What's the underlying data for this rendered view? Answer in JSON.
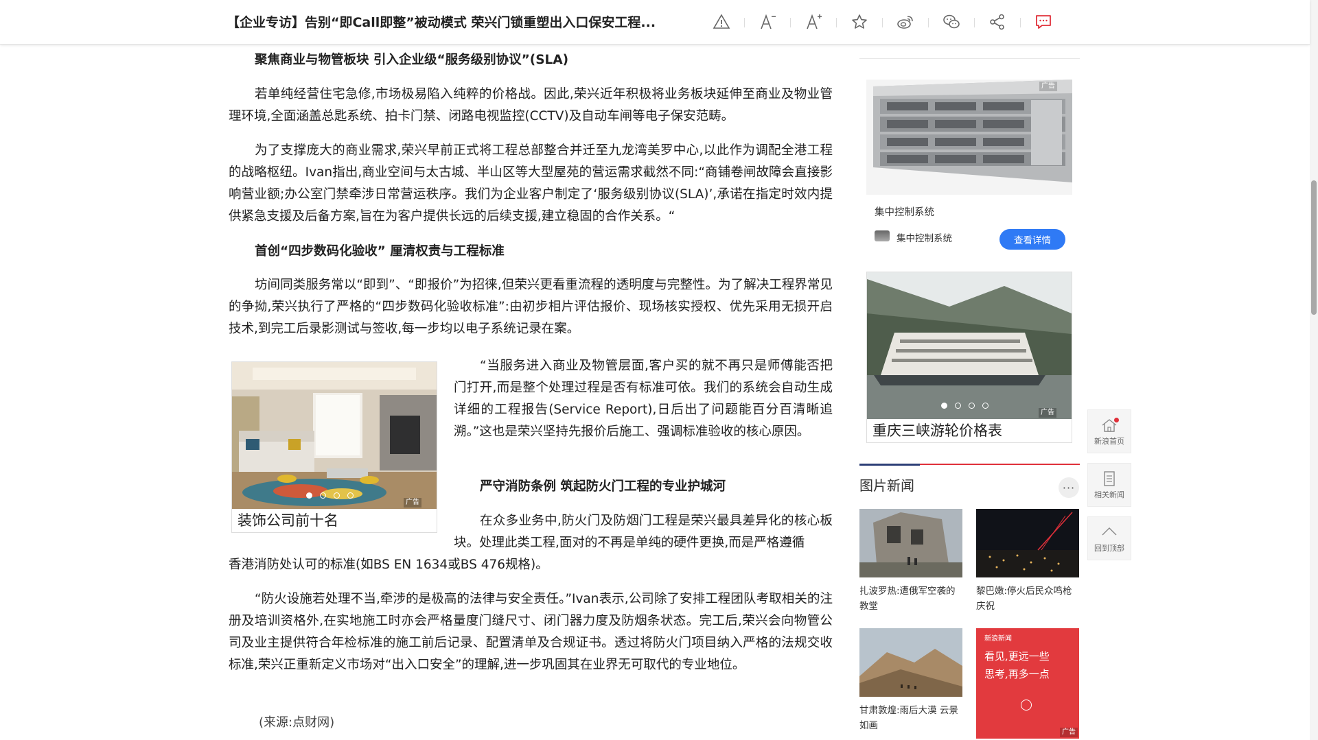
{
  "toolbar": {
    "title": "【企业专访】告别“即Call即整”被动模式 荣兴门锁重塑出入口保安工程...",
    "icons": [
      "warning-icon",
      "font-decrease-icon",
      "font-increase-icon",
      "star-icon",
      "weibo-icon",
      "wechat-icon",
      "share-icon",
      "comment-icon"
    ],
    "accent_color": "#e0303a"
  },
  "article": {
    "heading1": "聚焦商业与物管板块 引入企业级“服务级别协议”(SLA)",
    "para1": "若单纯经营住宅急修,市场极易陷入纯粹的价格战。因此,荣兴近年积极将业务板块延伸至商业及物业管理环境,全面涵盖总匙系统、拍卡门禁、闭路电视监控(CCTV)及自动车闸等电子保安范畴。",
    "para2": "为了支撑庞大的商业需求,荣兴早前正式将工程总部整合并迁至九龙湾美罗中心,以此作为调配全港工程的战略枢纽。Ivan指出,商业空间与太古城、半山区等大型屋苑的营运需求截然不同:“商铺卷闸故障会直接影响营业额;办公室门禁牵涉日常营运秩序。我们为企业客户制定了‘服务级别协议(SLA)’,承诺在指定时效内提供紧急支援及后备方案,旨在为客户提供长远的后续支援,建立稳固的合作关系。“",
    "heading2": "首创“四步数码化验收” 厘清权责与工程标准",
    "para3": "坊间同类服务常以“即到”、“即报价”为招徕,但荣兴更看重流程的透明度与完整性。为了解决工程界常见的争拗,荣兴执行了严格的“四步数码化验收标准”:由初步相片评估报价、现场核实授权、优先采用无损开启技术,到完工后录影测试与签收,每一步均以电子系统记录在案。",
    "para4": "“当服务进入商业及物管层面,客户买的就不再只是师傅能否把门打开,而是整个处理过程是否有标准可依。我们的系统会自动生成详细的工程报告(Service Report),日后出了问题能百分百清晰追溯。”这也是荣兴坚持先报价后施工、强调标准验收的核心原因。",
    "heading3": "严守消防条例 筑起防火门工程的专业护城河",
    "para5a": "在众多业务中,防火门及防烟门工程是荣兴最具差异化的核心板块。处理此类工程,面对的不再是单纯的硬件更换,而是严格遵循",
    "para5b": "香港消防处认可的标准(如BS EN 1634或BS 476规格)。",
    "para6": "“防火设施若处理不当,牵涉的是极高的法律与安全责任。”Ivan表示,公司除了安排工程团队考取相关的注册及培训资格外,在实地施工时亦会严格量度门缝尺寸、闭门器力度及防烟条状态。完工后,荣兴会向物管公司及业主提供符合年检标准的施工前后记录、配置清单及合规证书。透过将防火门项目纳入严格的法规交收标准,荣兴正重新定义市场对“出入口安全”的理解,进一步巩固其在业界无可取代的专业地位。",
    "source": "(来源:点财网)",
    "inline_ad": {
      "caption": "装饰公司前十名",
      "tag": "广告",
      "dots": 4
    }
  },
  "sidebar": {
    "ad1": {
      "title": "集中控制系统",
      "brand": "集中控制系统",
      "button": "查看详情",
      "tag": "广告"
    },
    "ad2": {
      "caption": "重庆三峡游轮价格表",
      "tag": "广告",
      "dots": 4
    },
    "section_title": "图片新闻",
    "more": "···",
    "news": [
      {
        "caption": "扎波罗热:遭俄军空袭的教堂"
      },
      {
        "caption": "黎巴嫩:停火后民众鸣枪庆祝"
      },
      {
        "caption": "甘肃敦煌:雨后大漠 云景如画"
      },
      {
        "caption": "",
        "ad_text1": "看见,更远一些",
        "ad_text2": "思考,再多一点",
        "ad_tag": "广告",
        "ad_brand": "新浪新闻"
      }
    ]
  },
  "sidenav": [
    {
      "label": "新浪首页"
    },
    {
      "label": "相关新闻"
    },
    {
      "label": "回到顶部"
    }
  ]
}
